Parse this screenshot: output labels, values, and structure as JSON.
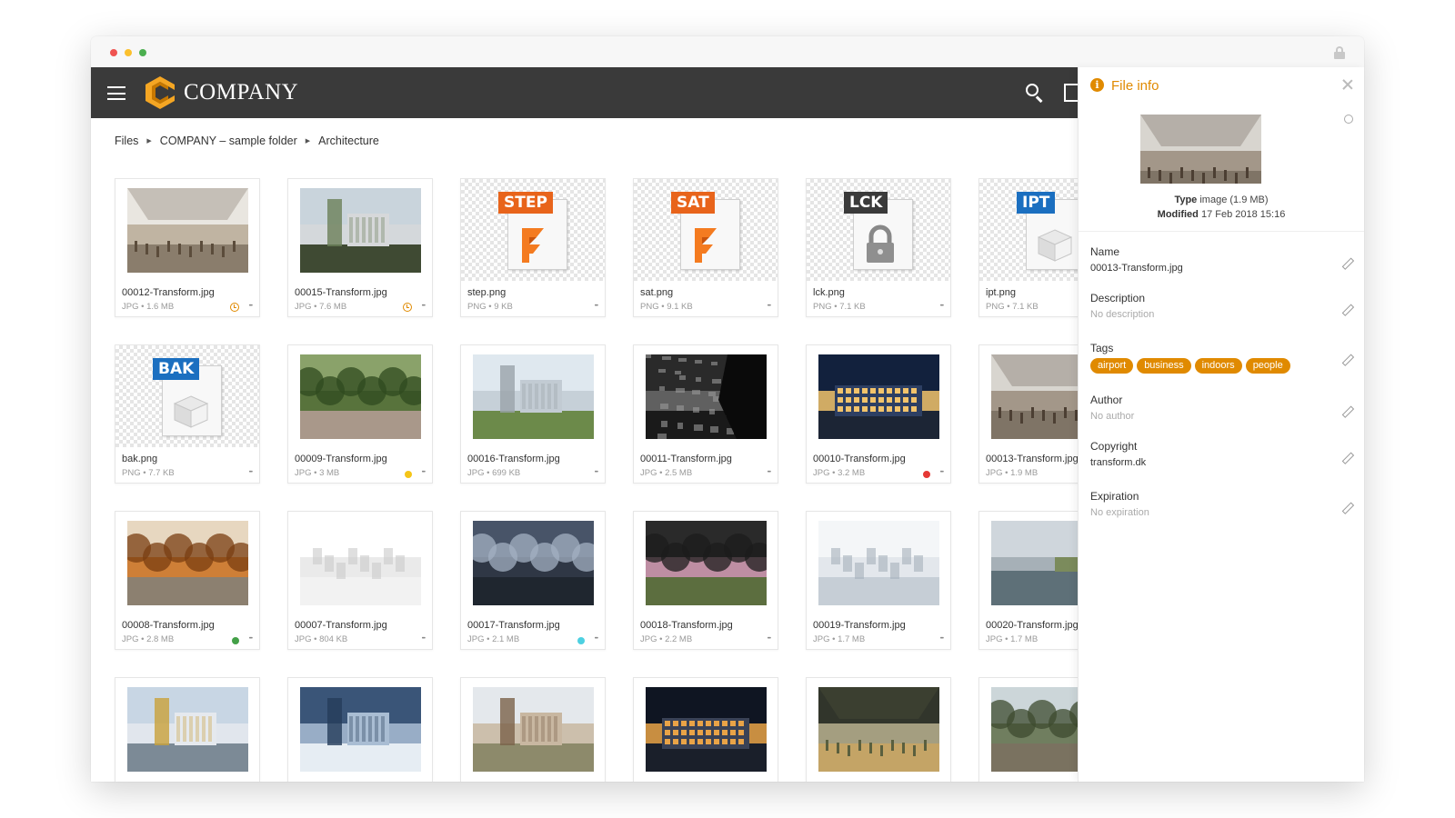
{
  "brand": {
    "name": "COMPANY",
    "accent": "#e08a00",
    "appbar_bg": "#3a3a3a"
  },
  "breadcrumb": [
    "Files",
    "COMPANY – sample folder",
    "Architecture"
  ],
  "files": [
    {
      "name": "00012-Transform.jpg",
      "meta": "JPG • 1.6 MB",
      "kind": "photo",
      "scene": "interior",
      "status": "clock"
    },
    {
      "name": "00015-Transform.jpg",
      "meta": "JPG • 7.6 MB",
      "kind": "photo",
      "scene": "tower",
      "status": "clock"
    },
    {
      "name": "step.png",
      "meta": "PNG • 9 KB",
      "kind": "fileicon",
      "badge": "STEP",
      "badge_color": "#e8641b",
      "glyph": "autodesk"
    },
    {
      "name": "sat.png",
      "meta": "PNG • 9.1 KB",
      "kind": "fileicon",
      "badge": "SAT",
      "badge_color": "#e8641b",
      "glyph": "autodesk"
    },
    {
      "name": "lck.png",
      "meta": "PNG • 7.1 KB",
      "kind": "fileicon",
      "badge": "LCK",
      "badge_color": "#3a3a3a",
      "glyph": "lock"
    },
    {
      "name": "ipt.png",
      "meta": "PNG • 7.1 KB",
      "kind": "fileicon",
      "badge": "IPT",
      "badge_color": "#1b6fc0",
      "glyph": "cube"
    },
    {
      "name": "bak.png",
      "meta": "PNG • 7.7 KB",
      "kind": "fileicon",
      "badge": "BAK",
      "badge_color": "#1b6fc0",
      "glyph": "cube"
    },
    {
      "name": "00009-Transform.jpg",
      "meta": "JPG • 3 MB",
      "kind": "photo",
      "scene": "park",
      "status": "#f5c518"
    },
    {
      "name": "00016-Transform.jpg",
      "meta": "JPG • 699 KB",
      "kind": "photo",
      "scene": "towers",
      "status": ""
    },
    {
      "name": "00011-Transform.jpg",
      "meta": "JPG • 2.5 MB",
      "kind": "photo",
      "scene": "map",
      "status": ""
    },
    {
      "name": "00010-Transform.jpg",
      "meta": "JPG • 3.2 MB",
      "kind": "photo",
      "scene": "night",
      "status": "#e53935"
    },
    {
      "name": "00013-Transform.jpg",
      "meta": "JPG • 1.9 MB",
      "kind": "photo",
      "scene": "interior2",
      "status": ""
    },
    {
      "name": "00008-Transform.jpg",
      "meta": "JPG • 2.8 MB",
      "kind": "photo",
      "scene": "autumn",
      "status": "#43a047"
    },
    {
      "name": "00007-Transform.jpg",
      "meta": "JPG • 804 KB",
      "kind": "photo",
      "scene": "model",
      "status": ""
    },
    {
      "name": "00017-Transform.jpg",
      "meta": "JPG • 2.1 MB",
      "kind": "photo",
      "scene": "dusk",
      "status": "#4dd0e1"
    },
    {
      "name": "00018-Transform.jpg",
      "meta": "JPG • 2.2 MB",
      "kind": "photo",
      "scene": "garden",
      "status": ""
    },
    {
      "name": "00019-Transform.jpg",
      "meta": "JPG • 1.7 MB",
      "kind": "photo",
      "scene": "snow",
      "status": ""
    },
    {
      "name": "00020-Transform.jpg",
      "meta": "JPG • 1.7 MB",
      "kind": "photo",
      "scene": "harbor",
      "status": ""
    },
    {
      "name": "",
      "meta": "",
      "kind": "photo",
      "scene": "gate",
      "status": ""
    },
    {
      "name": "",
      "meta": "",
      "kind": "photo",
      "scene": "winter",
      "status": ""
    },
    {
      "name": "",
      "meta": "",
      "kind": "photo",
      "scene": "apartments",
      "status": ""
    },
    {
      "name": "",
      "meta": "",
      "kind": "photo",
      "scene": "nightwide",
      "status": ""
    },
    {
      "name": "",
      "meta": "",
      "kind": "photo",
      "scene": "canopy",
      "status": ""
    },
    {
      "name": "",
      "meta": "",
      "kind": "photo",
      "scene": "street",
      "status": ""
    }
  ],
  "file_info": {
    "title": "File info",
    "type_label": "Type",
    "type_value": "image (1.9 MB)",
    "modified_label": "Modified",
    "modified_value": "17 Feb 2018 15:16",
    "name_label": "Name",
    "name_value": "00013-Transform.jpg",
    "description_label": "Description",
    "description_value": "No description",
    "tags_label": "Tags",
    "tags": [
      "airport",
      "business",
      "indoors",
      "people"
    ],
    "author_label": "Author",
    "author_value": "No author",
    "copyright_label": "Copyright",
    "copyright_value": "transform.dk",
    "expiration_label": "Expiration",
    "expiration_value": "No expiration"
  }
}
